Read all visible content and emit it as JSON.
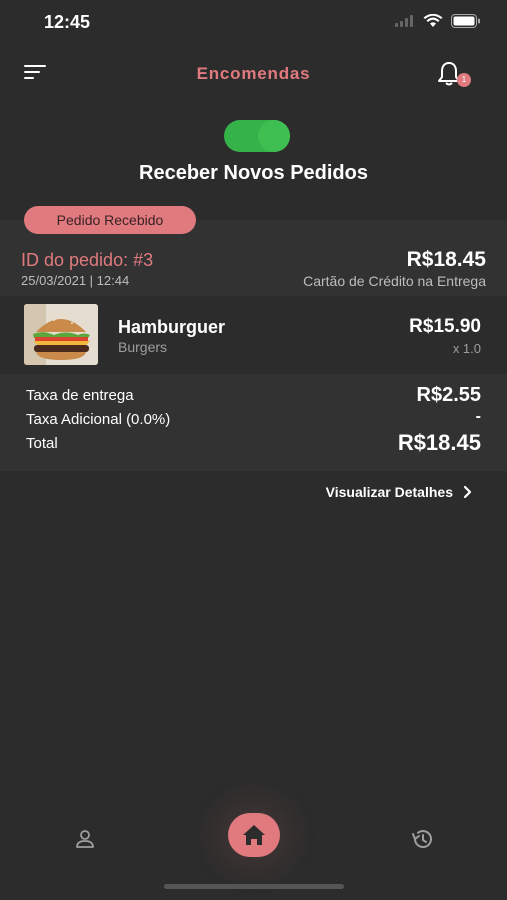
{
  "status_bar": {
    "time": "12:45"
  },
  "header": {
    "title": "Encomendas",
    "notification_count": "1"
  },
  "toggle": {
    "label": "Receber Novos Pedidos",
    "on": true,
    "color": "#3fbf51"
  },
  "order": {
    "status": "Pedido Recebido",
    "id_label": "ID do pedido: #3",
    "datetime": "25/03/2021 | 12:44",
    "total": "R$18.45",
    "payment": "Cartão de Crédito na Entrega",
    "items": [
      {
        "name": "Hamburguer",
        "category": "Burgers",
        "price": "R$15.90",
        "quantity": "x 1.0"
      }
    ],
    "summary": {
      "delivery_fee_label": "Taxa de entrega",
      "delivery_fee": "R$2.55",
      "additional_fee_label": "Taxa Adicional (0.0%)",
      "additional_fee": "-",
      "total_label": "Total",
      "total": "R$18.45"
    },
    "details_link": "Visualizar Detalhes"
  },
  "tabbar": {
    "items": [
      {
        "icon": "user-icon"
      },
      {
        "icon": "home-icon"
      },
      {
        "icon": "history-icon"
      }
    ]
  },
  "colors": {
    "background": "#2c2c2c",
    "accent": "#e07a7f",
    "toggle_green": "#3fbf51",
    "card": "#323232"
  }
}
